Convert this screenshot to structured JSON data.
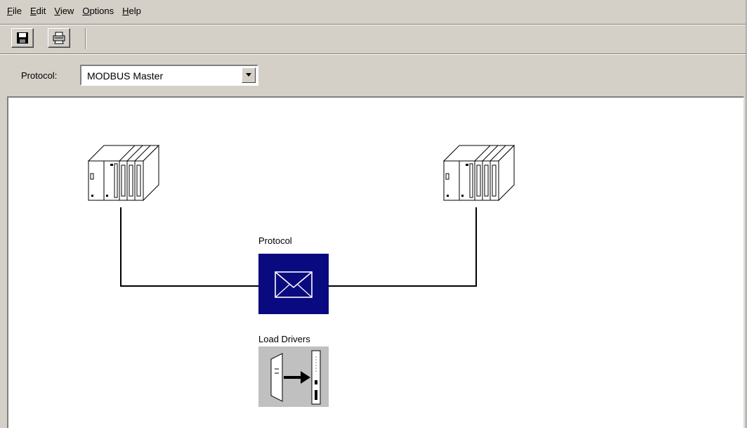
{
  "menu": {
    "items": [
      {
        "mnemonic": "F",
        "rest": "ile"
      },
      {
        "mnemonic": "E",
        "rest": "dit"
      },
      {
        "mnemonic": "V",
        "rest": "iew"
      },
      {
        "mnemonic": "O",
        "rest": "ptions"
      },
      {
        "mnemonic": "H",
        "rest": "elp"
      }
    ]
  },
  "toolbar": {
    "save_icon": "floppy-disk",
    "print_icon": "printer"
  },
  "protocol_row": {
    "label": "Protocol:",
    "selected": "MODBUS Master"
  },
  "diagram": {
    "protocol_label": "Protocol",
    "load_drivers_label": "Load Drivers",
    "colors": {
      "protocol_bg": "#0a0a80",
      "load_drivers_bg": "#c0c0c0",
      "line": "#000000"
    }
  }
}
